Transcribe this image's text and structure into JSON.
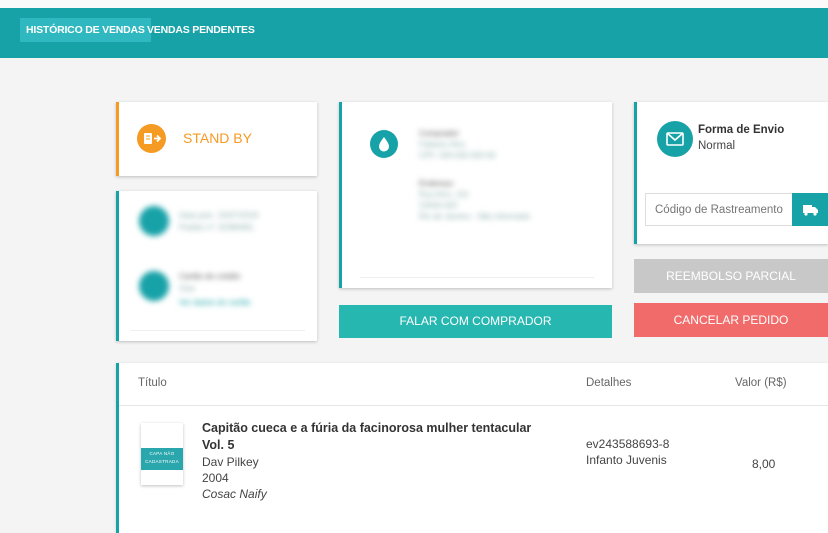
{
  "nav": {
    "tabs": [
      {
        "label": "HISTÓRICO DE VENDAS",
        "active": true
      },
      {
        "label": "VENDAS PENDENTES",
        "active": false
      }
    ]
  },
  "status": {
    "label": "STAND BY",
    "icon": "book-arrow-icon",
    "color": "#f59a23"
  },
  "seller_box": {
    "line1": "Data ped.: 20/07/2018",
    "line2": "Pedido nº: 32389481",
    "card_title": "Cartão de crédito",
    "card_sub": "Visa",
    "card_link": "Ver dados do cartão"
  },
  "buyer_box": {
    "title1": "Comprador",
    "name": "Fabiano Alvo",
    "cpf": "CPF: 000.000.000-00",
    "title2": "Endereço",
    "addr1": "Rua Alvo, 110",
    "addr2": "22000-000",
    "addr3": "Rio de Janeiro - Não informado"
  },
  "shipping": {
    "title": "Forma de Envio",
    "method": "Normal",
    "tracking_placeholder": "Código de Rastreamento",
    "icon": "envelope-icon",
    "button_icon": "truck-icon"
  },
  "buttons": {
    "contact": "FALAR COM COMPRADOR",
    "partial_refund": "REEMBOLSO PARCIAL",
    "cancel": "CANCELAR PEDIDO"
  },
  "colors": {
    "accent": "#17a2a8",
    "orange": "#f59a23",
    "danger": "#f26b6b",
    "disabled": "#c8c8c8",
    "contact": "#26b7b0"
  },
  "table": {
    "headers": {
      "title": "Título",
      "details": "Detalhes",
      "value": "Valor (R$)"
    },
    "rows": [
      {
        "title_line1": "Capitão cueca e a fúria da facinorosa mulher tentacular",
        "title_line2": "Vol. 5",
        "author": "Dav Pilkey",
        "year": "2004",
        "publisher": "Cosac Naify",
        "cover_text_1": "CAPA NÃO",
        "cover_text_2": "CADASTRADA",
        "code": "ev243588693-8",
        "category": "Infanto Juvenis",
        "value": "8,00"
      }
    ]
  }
}
